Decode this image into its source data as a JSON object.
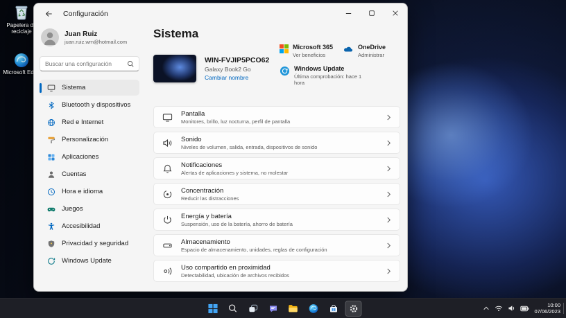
{
  "desktop": {
    "icons": [
      {
        "label": "Papelera de reciclaje",
        "icon": "recycle-bin-icon"
      },
      {
        "label": "Microsoft Edge",
        "icon": "edge-icon"
      }
    ]
  },
  "window": {
    "title": "Configuración",
    "user": {
      "name": "Juan Ruiz",
      "email": "juan.ruiz.wm@hotmail.com"
    },
    "search": {
      "placeholder": "Buscar una configuración",
      "icon": "search-icon"
    },
    "nav": [
      {
        "label": "Sistema",
        "icon": "system-icon",
        "selected": true
      },
      {
        "label": "Bluetooth y dispositivos",
        "icon": "bluetooth-icon"
      },
      {
        "label": "Red e Internet",
        "icon": "network-globe-icon"
      },
      {
        "label": "Personalización",
        "icon": "personalization-icon"
      },
      {
        "label": "Aplicaciones",
        "icon": "apps-icon"
      },
      {
        "label": "Cuentas",
        "icon": "accounts-icon"
      },
      {
        "label": "Hora e idioma",
        "icon": "time-language-icon"
      },
      {
        "label": "Juegos",
        "icon": "gaming-icon"
      },
      {
        "label": "Accesibilidad",
        "icon": "accessibility-icon"
      },
      {
        "label": "Privacidad y seguridad",
        "icon": "privacy-shield-icon"
      },
      {
        "label": "Windows Update",
        "icon": "windows-update-icon"
      }
    ],
    "main": {
      "title": "Sistema",
      "device": {
        "name": "WIN-FVJIP5PCO62",
        "model": "Galaxy Book2 Go",
        "rename_link": "Cambiar nombre"
      },
      "status_cards": [
        {
          "title": "Microsoft 365",
          "subtitle": "Ver beneficios",
          "icon": "microsoft-365-icon"
        },
        {
          "title": "OneDrive",
          "subtitle": "Administrar",
          "icon": "onedrive-icon"
        },
        {
          "title": "Windows Update",
          "subtitle": "Última comprobación: hace 1 hora",
          "icon": "windows-update-icon"
        }
      ],
      "rows": [
        {
          "title": "Pantalla",
          "subtitle": "Monitores, brillo, luz nocturna, perfil de pantalla",
          "icon": "display-icon"
        },
        {
          "title": "Sonido",
          "subtitle": "Niveles de volumen, salida, entrada, dispositivos de sonido",
          "icon": "sound-icon"
        },
        {
          "title": "Notificaciones",
          "subtitle": "Alertas de aplicaciones y sistema, no molestar",
          "icon": "bell-icon"
        },
        {
          "title": "Concentración",
          "subtitle": "Reducir las distracciones",
          "icon": "focus-icon"
        },
        {
          "title": "Energía y batería",
          "subtitle": "Suspensión, uso de la batería, ahorro de batería",
          "icon": "power-icon"
        },
        {
          "title": "Almacenamiento",
          "subtitle": "Espacio de almacenamiento, unidades, reglas de configuración",
          "icon": "storage-icon"
        },
        {
          "title": "Uso compartido en proximidad",
          "subtitle": "Detectabilidad, ubicación de archivos recibidos",
          "icon": "nearby-share-icon"
        }
      ]
    }
  },
  "taskbar": {
    "buttons": [
      "start",
      "search",
      "task-view",
      "chat",
      "file-explorer",
      "edge",
      "store",
      "settings"
    ],
    "active_button": "settings",
    "tray": {
      "icons": [
        "chevron-up",
        "network",
        "volume",
        "battery"
      ],
      "time": "10:00",
      "date": "07/06/2023"
    }
  },
  "colors": {
    "accent": "#0067c0",
    "link": "#0067c0",
    "nav_selected_bg": "#eaeaea",
    "taskbar_bg": "#1e1f26",
    "window_bg": "#f5f5f5",
    "row_bg": "#fdfdfd"
  }
}
